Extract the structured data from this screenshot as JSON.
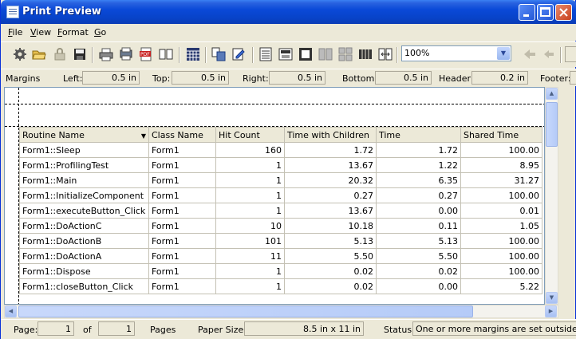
{
  "window": {
    "title": "Print Preview"
  },
  "menu": {
    "items": [
      {
        "acc": "F",
        "rest": "ile"
      },
      {
        "acc": "V",
        "rest": "iew"
      },
      {
        "acc": "F",
        "rest": "ormat"
      },
      {
        "acc": "G",
        "rest": "o"
      }
    ]
  },
  "toolbar": {
    "zoom_value": "100%"
  },
  "margins": {
    "label": "Margins",
    "left_label": "Left:",
    "left_value": "0.5 in",
    "top_label": "Top:",
    "top_value": "0.5 in",
    "right_label": "Right:",
    "right_value": "0.5 in",
    "bottom_label": "Bottom:",
    "bottom_value": "0.5 in",
    "header_label": "Header:",
    "header_value": "0.2 in",
    "footer_label": "Footer:"
  },
  "table": {
    "columns": [
      "Routine Name",
      "Class Name",
      "Hit Count",
      "Time with Children",
      "Time",
      "Shared Time"
    ],
    "rows": [
      [
        "Form1::Sleep",
        "Form1",
        "160",
        "1.72",
        "1.72",
        "100.00"
      ],
      [
        "Form1::ProfilingTest",
        "Form1",
        "1",
        "13.67",
        "1.22",
        "8.95"
      ],
      [
        "Form1::Main",
        "Form1",
        "1",
        "20.32",
        "6.35",
        "31.27"
      ],
      [
        "Form1::InitializeComponent",
        "Form1",
        "1",
        "0.27",
        "0.27",
        "100.00"
      ],
      [
        "Form1::executeButton_Click",
        "Form1",
        "1",
        "13.67",
        "0.00",
        "0.01"
      ],
      [
        "Form1::DoActionC",
        "Form1",
        "10",
        "10.18",
        "0.11",
        "1.05"
      ],
      [
        "Form1::DoActionB",
        "Form1",
        "101",
        "5.13",
        "5.13",
        "100.00"
      ],
      [
        "Form1::DoActionA",
        "Form1",
        "11",
        "5.50",
        "5.50",
        "100.00"
      ],
      [
        "Form1::Dispose",
        "Form1",
        "1",
        "0.02",
        "0.02",
        "100.00"
      ],
      [
        "Form1::closeButton_Click",
        "Form1",
        "1",
        "0.02",
        "0.00",
        "5.22"
      ]
    ]
  },
  "status": {
    "page_label": "Page:",
    "page_value": "1",
    "of_label": "of",
    "of_value": "1",
    "pages_label": "Pages",
    "paper_label": "Paper Size:",
    "paper_value": "8.5 in x 11 in",
    "status_label": "Status:",
    "status_value": "One or more margins are set outside the printable"
  },
  "colors": {
    "title_bar": "#0a49d8",
    "face": "#ece9d8",
    "border": "#7f9db9"
  }
}
